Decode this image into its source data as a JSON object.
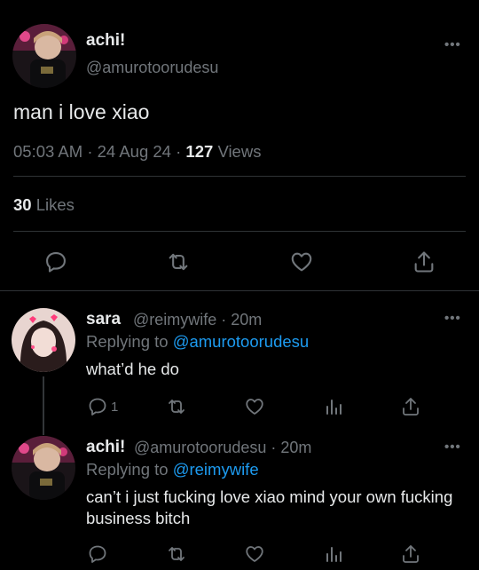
{
  "tweet": {
    "name": "achi!",
    "handle": "@amurotoorudesu",
    "text": "man i love xiao",
    "time": "05:03 AM",
    "date": "24 Aug 24",
    "views_count": "127",
    "views_label": "Views",
    "separator": "·",
    "likes_count": "30",
    "likes_label": "Likes",
    "more": "•••"
  },
  "replies": [
    {
      "name": "sara",
      "handle_time": "@reimywife · 20m",
      "replying_prefix": "Replying to",
      "replying_to": "@amurotoorudesu",
      "text": "what’d he do",
      "reply_count": "1",
      "more": "•••"
    },
    {
      "name": "achi!",
      "handle_time": "@amurotoorudesu · 20m",
      "replying_prefix": "Replying to",
      "replying_to": "@reimywife",
      "text": "can’t i just fucking love xiao mind your own fucking business bitch",
      "more": "•••"
    }
  ],
  "colors": {
    "background": "#000000",
    "text": "#e7e9ea",
    "muted": "#71767b",
    "mention": "#1d9bf0",
    "divider": "#2f3336"
  },
  "icons": [
    "reply-icon",
    "retweet-icon",
    "like-icon",
    "views-icon",
    "share-icon",
    "more-icon"
  ]
}
